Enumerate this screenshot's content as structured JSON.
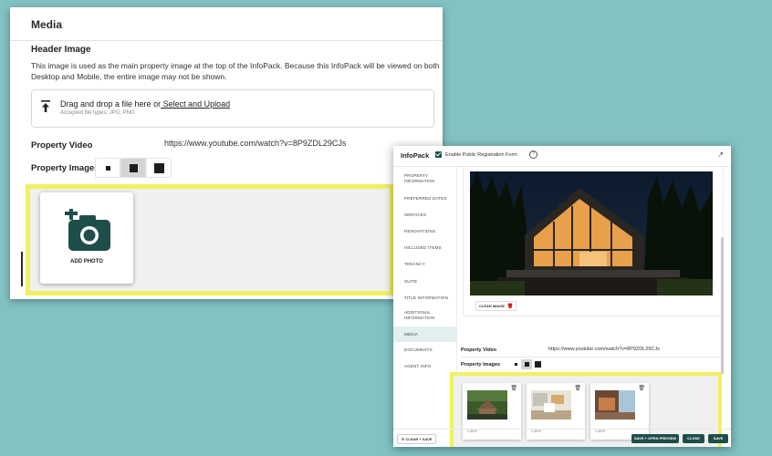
{
  "panel1": {
    "title": "Media",
    "header_image_label": "Header Image",
    "header_image_description": "This image is used as the main property image at the top of the InfoPack. Because this InfoPack will be viewed on both Desktop and Mobile, the entire image may not be shown.",
    "dropzone": {
      "text": "Drag and drop a file here or",
      "link": " Select and Upload",
      "accepted": "Accepted file types: JPG, PNG",
      "icon": "upload-icon"
    },
    "property_video_label": "Property Video",
    "property_video_url": "https://www.youtube.com/watch?v=8P9ZDL29CJs",
    "property_images_label": "Property Images",
    "add_photo_label": "ADD PHOTO",
    "highlight_color": "#f1f061"
  },
  "panel2": {
    "brand": "InfoPack",
    "enable_label": "Enable Public Registration Form",
    "nav": [
      {
        "label": "PROPERTY INFORMATION"
      },
      {
        "label": "PREFERRED DATES"
      },
      {
        "label": "SERVICES"
      },
      {
        "label": "RENOVATIONS"
      },
      {
        "label": "INCLUDED ITEMS"
      },
      {
        "label": "TENANCY"
      },
      {
        "label": "SUITE"
      },
      {
        "label": "TITLE INFORMATION"
      },
      {
        "label": "ADDITIONAL INFORMATION"
      },
      {
        "label": "MEDIA"
      },
      {
        "label": "DOCUMENTS"
      },
      {
        "label": "AGENT INFO"
      }
    ],
    "active_nav": "MEDIA",
    "clear_image_label": "CLEAR IMAGE",
    "property_video_label": "Property Video",
    "property_video_url": "https://www.youtube.com/watch?v=8P9ZDL29CJs",
    "property_images_label": "Property Images",
    "cards": [
      {
        "label": "Label"
      },
      {
        "label": "Label"
      },
      {
        "label": "Label"
      }
    ],
    "buttons": {
      "clear_save": "CLEAR + SAVE",
      "save_open_preview": "SAVE + OPEN PREVIEW",
      "close": "CLOSE",
      "save": "SAVE"
    },
    "accent_color": "#1f4e4a"
  }
}
